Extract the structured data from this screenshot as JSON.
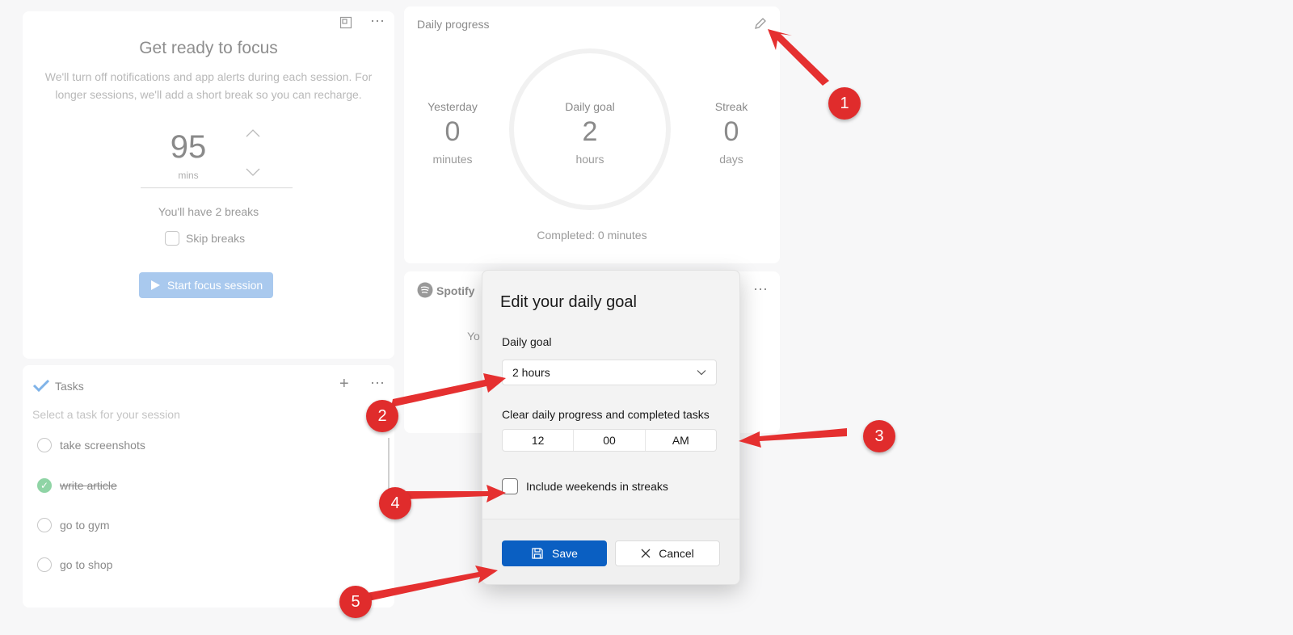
{
  "focus": {
    "title": "Get ready to focus",
    "description": "We'll turn off notifications and app alerts during each session. For longer sessions, we'll add a short break so you can recharge.",
    "minutes_value": "95",
    "minutes_unit": "mins",
    "breaks_text": "You'll have 2 breaks",
    "skip_breaks_label": "Skip breaks",
    "start_label": "Start focus session",
    "more_icon": "⋯"
  },
  "tasks": {
    "title": "Tasks",
    "placeholder": "Select a task for your session",
    "items": [
      {
        "label": "take screenshots",
        "done": false
      },
      {
        "label": "write article",
        "done": true
      },
      {
        "label": "go to gym",
        "done": false
      },
      {
        "label": "go to shop",
        "done": false
      }
    ]
  },
  "progress": {
    "title": "Daily progress",
    "yesterday_label": "Yesterday",
    "yesterday_value": "0",
    "yesterday_unit": "minutes",
    "goal_label": "Daily goal",
    "goal_value": "2",
    "goal_unit": "hours",
    "streak_label": "Streak",
    "streak_value": "0",
    "streak_unit": "days",
    "completed_text": "Completed: 0 minutes"
  },
  "spotify": {
    "brand": "Spotify",
    "partial_text": "Yo"
  },
  "dialog": {
    "title": "Edit your daily goal",
    "goal_label": "Daily goal",
    "goal_value": "2 hours",
    "clear_label": "Clear daily progress and completed tasks",
    "time_hour": "12",
    "time_minute": "00",
    "time_ampm": "AM",
    "weekend_label": "Include weekends in streaks",
    "save_label": "Save",
    "cancel_label": "Cancel"
  },
  "markers": [
    "1",
    "2",
    "3",
    "4",
    "5"
  ],
  "colors": {
    "accent": "#0a5fc2",
    "marker": "#e02c2c",
    "task_done": "#8fd4a5"
  }
}
